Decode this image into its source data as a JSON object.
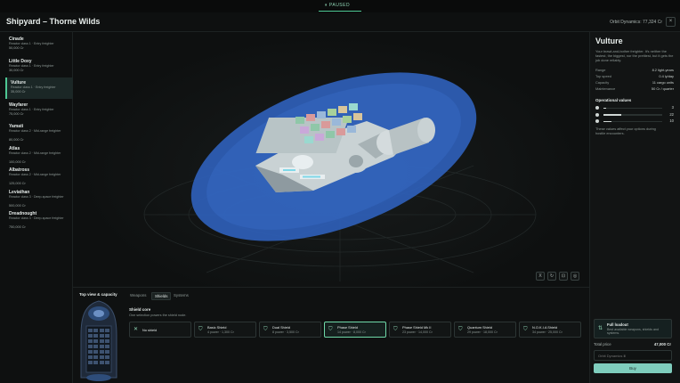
{
  "status": {
    "paused_label": "⏸ PAUSED"
  },
  "header": {
    "title": "Shipyard – Thorne Wilds",
    "balance": "Orbit Dynamics: 77,324 Cr",
    "close_label": "×"
  },
  "ships": [
    {
      "name": "Cinade",
      "desc": "Reactor class 1 · Entry freighter",
      "price": "50,000 Cr"
    },
    {
      "name": "Little Doxy",
      "desc": "Reactor class 1 · Entry freighter",
      "price": "30,000 Cr"
    },
    {
      "name": "Vulture",
      "desc": "Reactor class 1 · Entry freighter",
      "price": "35,000 Cr",
      "selected": true
    },
    {
      "name": "Wayfarer",
      "desc": "Reactor class 1 · Entry freighter",
      "price": "75,000 Cr"
    },
    {
      "name": "Yamati",
      "desc": "Reactor class 2 · Mid-range freighter",
      "price": "80,000 Cr"
    },
    {
      "name": "Atlas",
      "desc": "Reactor class 2 · Mid-range freighter",
      "price": "100,000 Cr"
    },
    {
      "name": "Albatross",
      "desc": "Reactor class 2 · Mid-range freighter",
      "price": "125,000 Cr"
    },
    {
      "name": "Leviathan",
      "desc": "Reactor class 3 · Deep-space freighter",
      "price": "500,000 Cr"
    },
    {
      "name": "Dreadnought",
      "desc": "Reactor class 3 · Deep-space freighter",
      "price": "750,000 Cr"
    }
  ],
  "viewport_controls": [
    "X",
    "↻",
    "⊡",
    "◎"
  ],
  "detail": {
    "name": "Vulture",
    "description": "Your brawl-and-bother freighter. It's neither the fastest, the biggest, nor the prettiest, but it gets the job done reliably.",
    "stats": [
      {
        "label": "Range",
        "value": "8.2 light-years"
      },
      {
        "label": "Top speed",
        "value": "0.4 ly/day"
      },
      {
        "label": "Capacity",
        "value": "11 cargo units"
      },
      {
        "label": "Maintenance",
        "value": "50 Cr / quarter"
      }
    ],
    "operational_heading": "Operational values",
    "operational": [
      {
        "value": "3",
        "fraction": 0.05
      },
      {
        "value": "22",
        "fraction": 0.3
      },
      {
        "value": "10",
        "fraction": 0.14
      }
    ],
    "operational_note": "These values affect your options during hostile encounters."
  },
  "bottom": {
    "topview_label": "Top view & capacity",
    "tabs": [
      "Weapons",
      "Shields",
      "Systems"
    ],
    "active_tab": 1,
    "shield_title": "Shield core",
    "shield_desc": "One selection powers the shield node.",
    "shield_options": [
      {
        "name": "No shield",
        "sub": "",
        "icon": "✕"
      },
      {
        "name": "Basic Shield",
        "sub": "4 power · 1,300 Cr",
        "icon": "⛉"
      },
      {
        "name": "Dual Shield",
        "sub": "8 power · 3,500 Cr",
        "icon": "⛉"
      },
      {
        "name": "Phase Shield",
        "sub": "14 power · 8,000 Cr",
        "icon": "⛉",
        "selected": true
      },
      {
        "name": "Phase Shield Mk II",
        "sub": "23 power · 14,000 Cr",
        "icon": "⛉"
      },
      {
        "name": "Quantum Shield",
        "sub": "29 power · 18,000 Cr",
        "icon": "⛉"
      },
      {
        "name": "N.O.K.I.A Shield",
        "sub": "34 power · 25,000 Cr",
        "icon": "⛉"
      }
    ]
  },
  "purchase": {
    "full_loadout_title": "Full loadout",
    "full_loadout_desc": "Best available weapons, shields and systems.",
    "total_label": "Total price",
    "total_value": "47,000 Cr",
    "account_placeholder": "Orbit Dynamics ⅲ",
    "buy_label": "Buy"
  },
  "colors": {
    "accent": "#4ec894",
    "shield_ellipse": "#2f5fb8",
    "buy": "#7fcdbd"
  }
}
